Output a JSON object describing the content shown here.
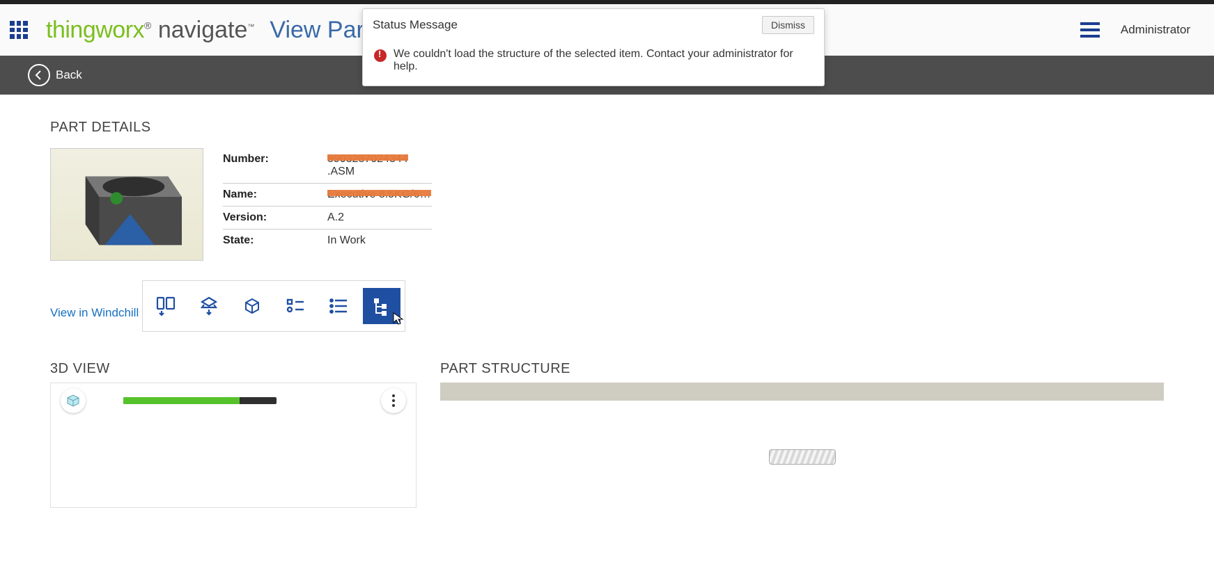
{
  "header": {
    "brand1": "thingworx",
    "brand1_mark": "®",
    "brand2": "navigate",
    "brand2_mark": "™",
    "page_title": "View Part",
    "user": "Administrator"
  },
  "backbar": {
    "label": "Back"
  },
  "toast": {
    "title": "Status Message",
    "dismiss": "Dismiss",
    "message": "We couldn't load the structure of the selected item. Contact your administrator for help."
  },
  "details": {
    "title": "PART DETAILS",
    "rows": [
      {
        "label": "Number:",
        "value_redacted": "8903287024344",
        "value_suffix": ".ASM"
      },
      {
        "label": "Name:",
        "value_redacted": "Executive 8.5KG/6…",
        "value_suffix": ""
      },
      {
        "label": "Version:",
        "value_redacted": "",
        "value_suffix": "A.2"
      },
      {
        "label": "State:",
        "value_redacted": "",
        "value_suffix": "In Work"
      }
    ],
    "view_link": "View in Windchill"
  },
  "toolbar": {
    "items": [
      {
        "name": "download-drawing",
        "active": false
      },
      {
        "name": "download-cad",
        "active": false
      },
      {
        "name": "cube-view",
        "active": false
      },
      {
        "name": "attributes",
        "active": false
      },
      {
        "name": "list",
        "active": false
      },
      {
        "name": "structure-tree",
        "active": true
      }
    ]
  },
  "lower": {
    "view3d_title": "3D VIEW",
    "structure_title": "PART STRUCTURE",
    "progress_percent": 76
  }
}
